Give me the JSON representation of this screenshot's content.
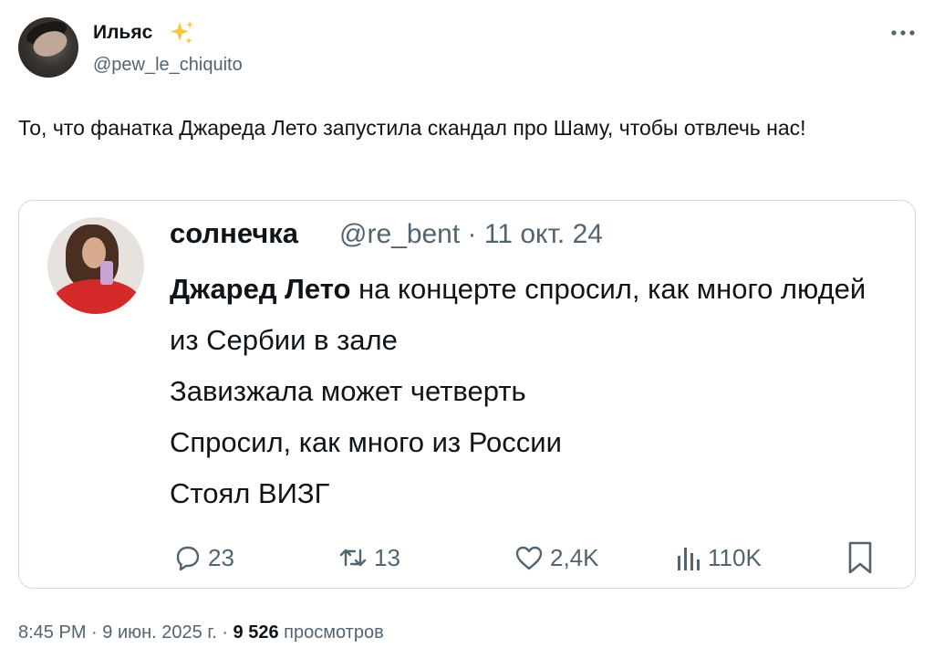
{
  "tweet": {
    "author": {
      "name": "Ильяс",
      "emoji": "✨",
      "handle": "@pew_le_chiquito"
    },
    "text": "То, что фанатка Джареда Лето запустила скандал про Шаму, чтобы отвлечь нас!",
    "timestamp": "8:45 PM",
    "date": "9 июн. 2025 г.",
    "separator": "·",
    "views_count": "9 526",
    "views_label": "просмотров"
  },
  "quote": {
    "author": {
      "name": "солнечка",
      "handle": "@re_bent",
      "date": "· 11 окт. 24"
    },
    "text_bold": "Джаред Лето",
    "text_rest": " на концерте спросил, как много людей из Сербии в зале",
    "line3": "Завизжала может четверть",
    "line4": "Спросил, как много из России",
    "line5": "Стоял ВИЗГ",
    "stats": {
      "replies": "23",
      "reposts": "13",
      "likes": "2,4K",
      "views": "110K"
    }
  },
  "icons": {
    "more": "more-dots-icon",
    "reply": "reply-bubble-icon",
    "repost": "repost-icon",
    "like": "heart-icon",
    "views": "bar-chart-icon",
    "bookmark": "bookmark-icon",
    "sparkle": "sparkles-icon"
  },
  "colors": {
    "text": "#0f1419",
    "secondary": "#536471",
    "border": "#cfd9de",
    "sparkle": "#f7c744"
  }
}
